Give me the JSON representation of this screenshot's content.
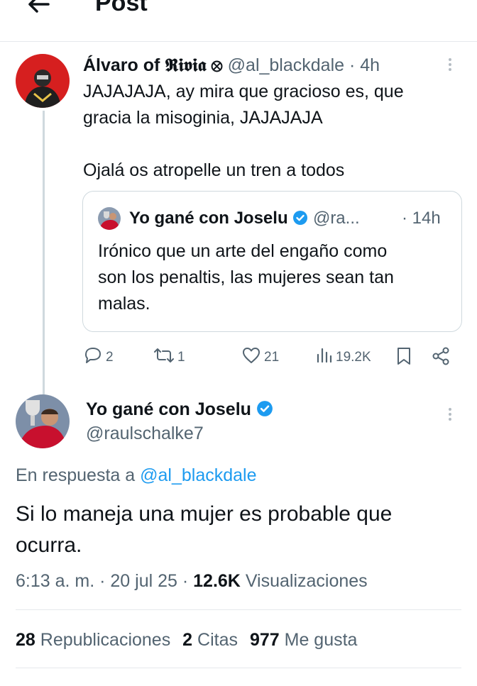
{
  "header": {
    "title": "Post"
  },
  "parent_post": {
    "author_name": "Álvaro of 𝕽𝖎𝖛𝖎𝖆 ⊗",
    "handle": "@al_blackdale",
    "time": "· 4h",
    "text_line1": "JAJAJAJA, ay mira que gracioso es, que",
    "text_line2": "gracia la misoginia, JAJAJAJA",
    "text_line3": "Ojalá os atropelle un tren a todos",
    "quote": {
      "author_name": "Yo gané con Joselu",
      "handle": "@ra...",
      "time": "· 14h",
      "text_line1": "Irónico que un arte del engaño como",
      "text_line2": "son los penaltis, las mujeres sean tan",
      "text_line3": "malas."
    },
    "actions": {
      "replies": "2",
      "reposts": "1",
      "likes": "21",
      "views": "19.2K"
    }
  },
  "main_post": {
    "author_name": "Yo gané con Joselu",
    "handle": "@raulschalke7",
    "reply_prefix": "En respuesta a",
    "reply_to": "@al_blackdale",
    "text_line1": "Si lo maneja una mujer es probable que",
    "text_line2": "ocurra.",
    "timestamp": "6:13 a. m. · 20 jul 25 ·",
    "views_count": "12.6K",
    "views_label": "Visualizaciones",
    "stats": {
      "reposts_count": "28",
      "reposts_label": "Republicaciones",
      "quotes_count": "2",
      "quotes_label": "Citas",
      "likes_count": "977",
      "likes_label": "Me gusta"
    }
  },
  "colors": {
    "accent": "#1d9bf0",
    "muted": "#536471",
    "text": "#0f1419",
    "border": "#e6e9ec"
  }
}
